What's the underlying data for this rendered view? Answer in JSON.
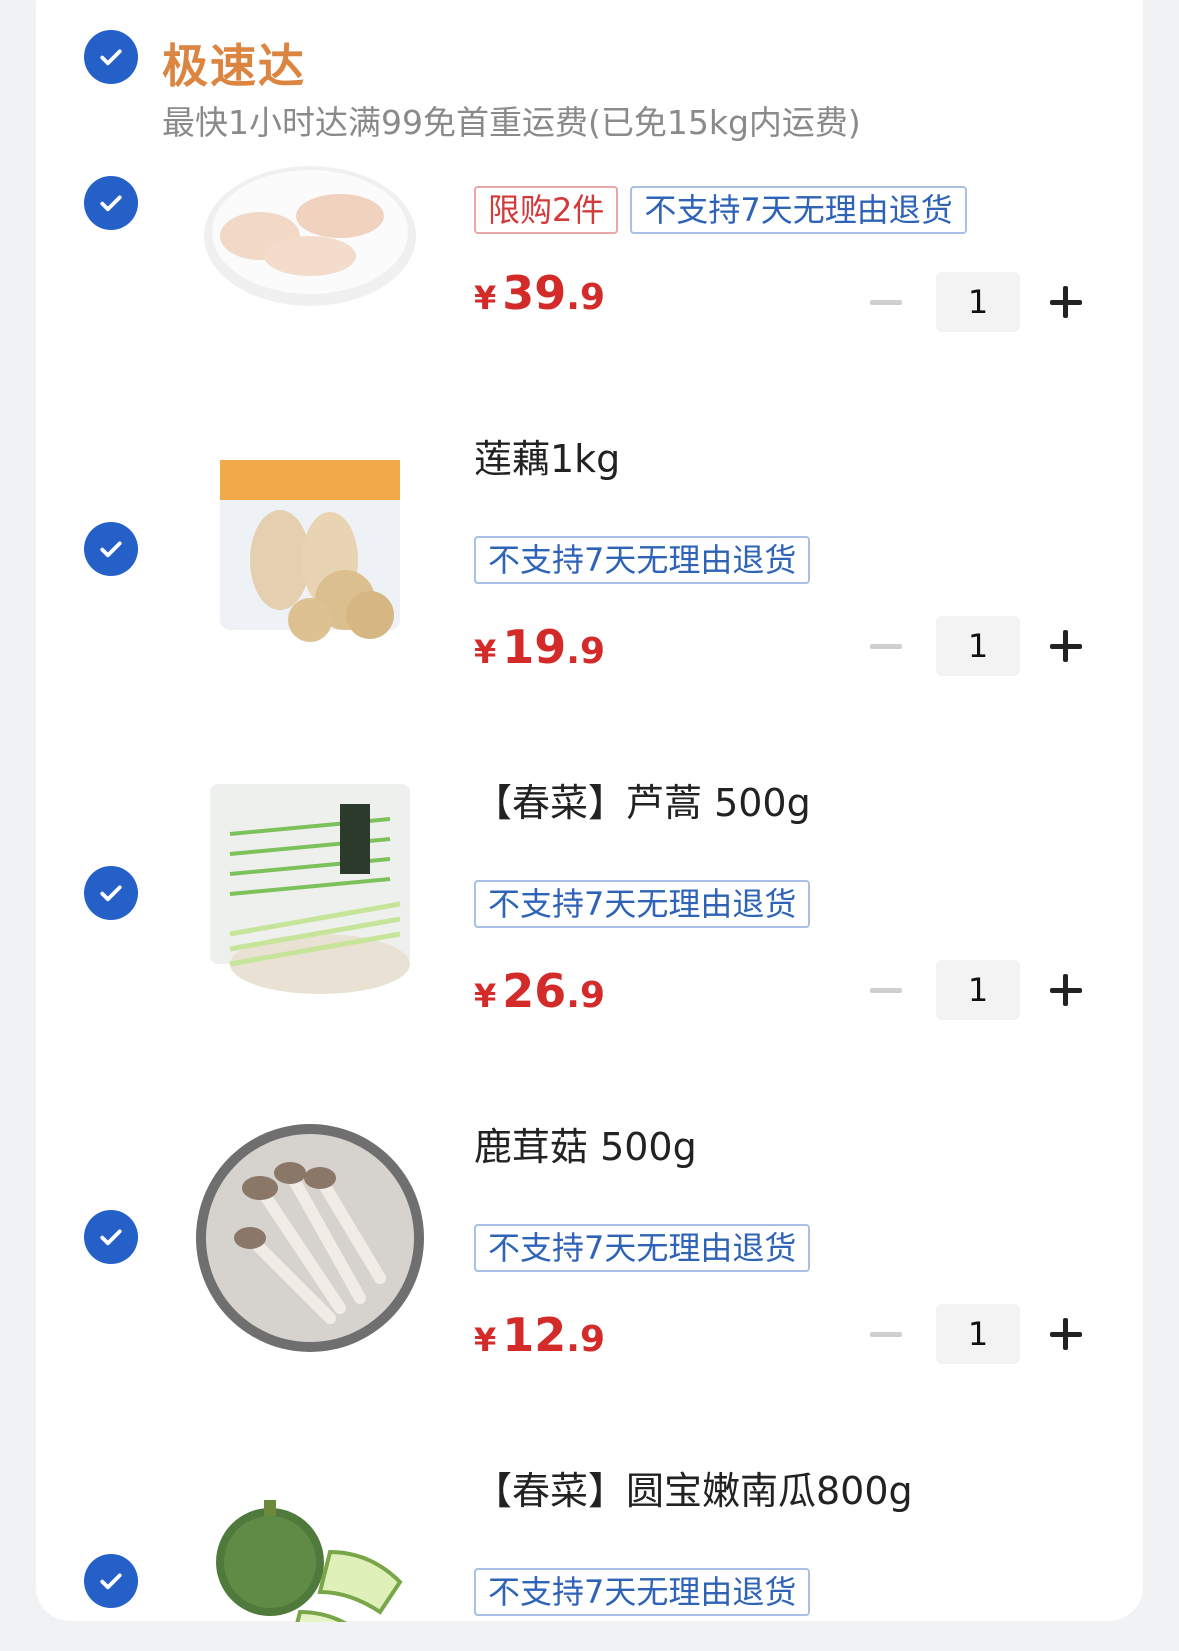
{
  "shop": {
    "name": "极速达",
    "subtitle": "最快1小时达满99免首重运费(已免15kg内运费)"
  },
  "items": [
    {
      "title": "",
      "tags": [
        {
          "text": "限购2件",
          "style": "red"
        },
        {
          "text": "不支持7天无理由退货",
          "style": "blue"
        }
      ],
      "price": {
        "symbol": "¥",
        "int": "39",
        "dec": ".9"
      },
      "quantity": "1",
      "image": "chicken-drumsticks"
    },
    {
      "title": "莲藕1kg",
      "tags": [
        {
          "text": "不支持7天无理由退货",
          "style": "blue"
        }
      ],
      "price": {
        "symbol": "¥",
        "int": "19",
        "dec": ".9"
      },
      "quantity": "1",
      "image": "lotus-root"
    },
    {
      "title": "【春菜】芦蒿 500g",
      "tags": [
        {
          "text": "不支持7天无理由退货",
          "style": "blue"
        }
      ],
      "price": {
        "symbol": "¥",
        "int": "26",
        "dec": ".9"
      },
      "quantity": "1",
      "image": "artemisia"
    },
    {
      "title": "鹿茸菇 500g",
      "tags": [
        {
          "text": "不支持7天无理由退货",
          "style": "blue"
        }
      ],
      "price": {
        "symbol": "¥",
        "int": "12",
        "dec": ".9"
      },
      "quantity": "1",
      "image": "mushrooms"
    },
    {
      "title": "【春菜】圆宝嫩南瓜800g",
      "tags": [
        {
          "text": "不支持7天无理由退货",
          "style": "blue"
        }
      ],
      "image": "zucchini"
    }
  ],
  "colors": {
    "accent": "#2460c8",
    "shop_name": "#dc8540",
    "price": "#d32a2a"
  }
}
